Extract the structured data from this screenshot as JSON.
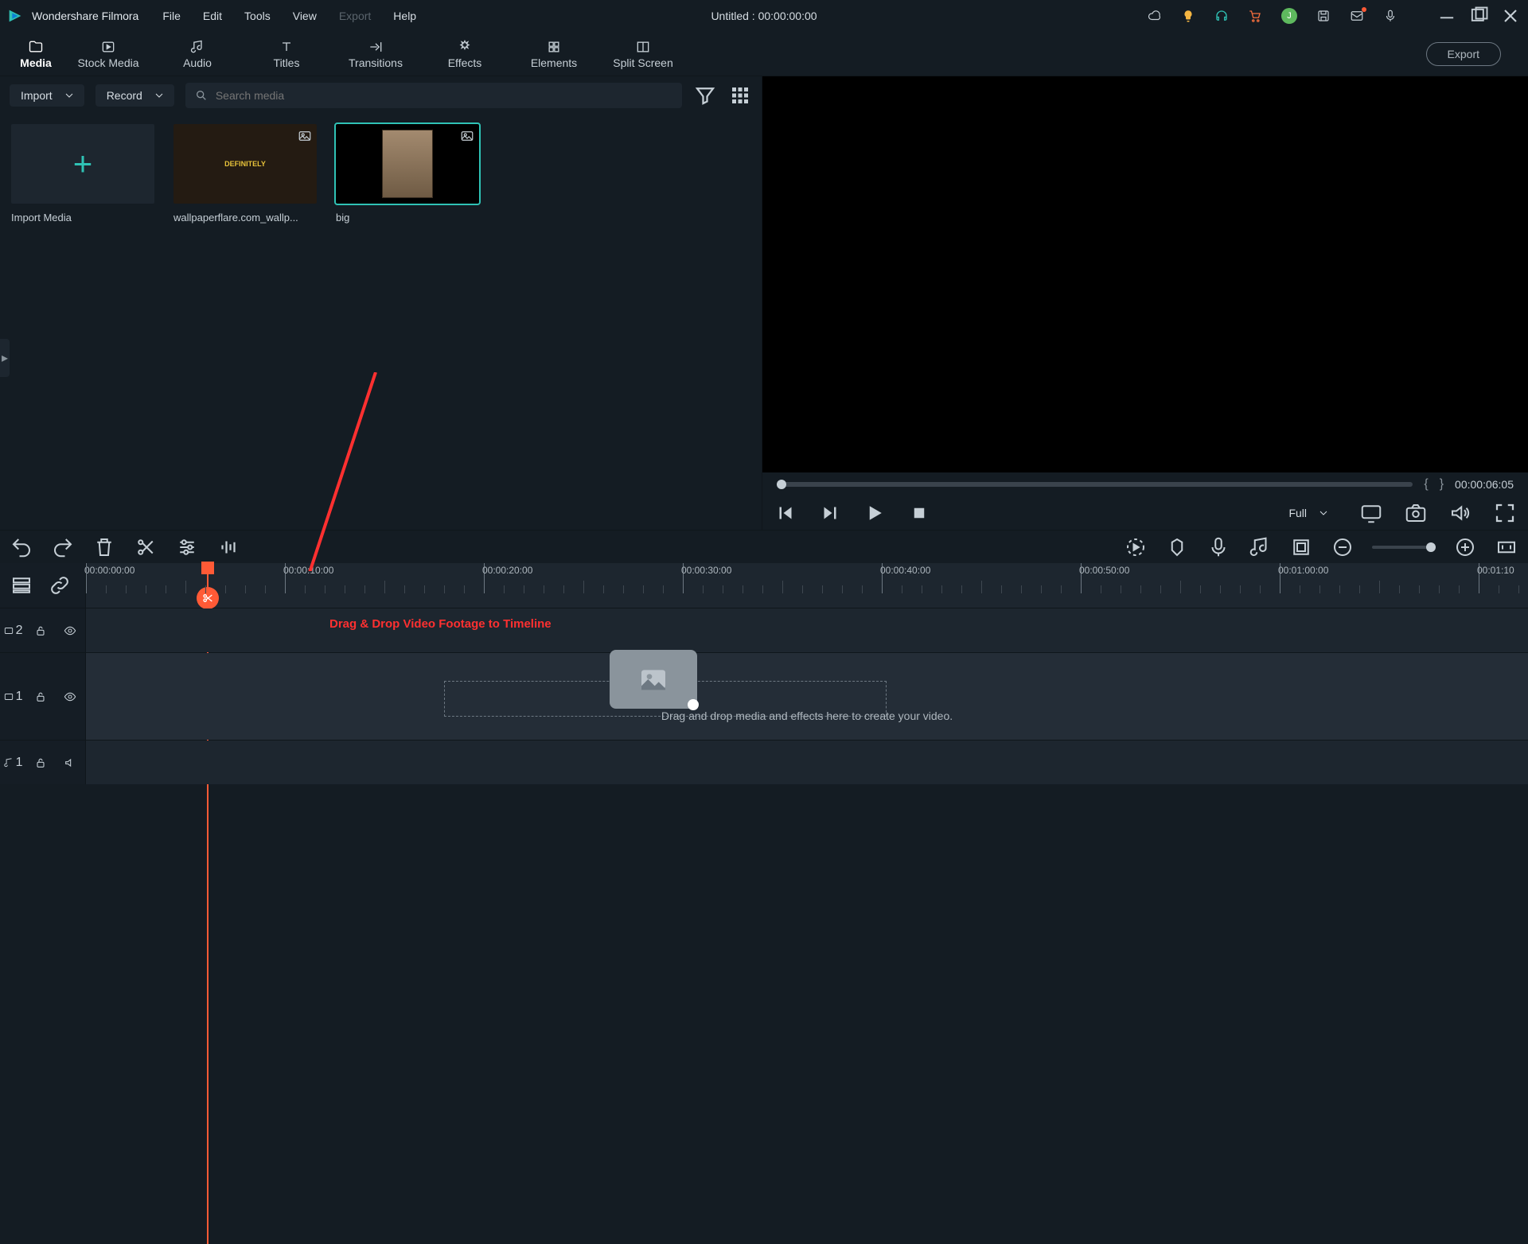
{
  "app": {
    "name": "Wondershare Filmora",
    "title_center": "Untitled : 00:00:00:00"
  },
  "menu": {
    "file": "File",
    "edit": "Edit",
    "tools": "Tools",
    "view": "View",
    "export": "Export",
    "help": "Help"
  },
  "nav": {
    "media": "Media",
    "stock": "Stock Media",
    "audio": "Audio",
    "titles": "Titles",
    "transitions": "Transitions",
    "effects": "Effects",
    "elements": "Elements",
    "split": "Split Screen",
    "export_btn": "Export"
  },
  "mediabar": {
    "import": "Import",
    "record": "Record",
    "search_placeholder": "Search media"
  },
  "tiles": {
    "import": "Import Media",
    "t1": "wallpaperflare.com_wallp...",
    "t2": "big"
  },
  "preview": {
    "time": "00:00:06:05",
    "mode": "Full"
  },
  "ruler": {
    "start": "00:00:00:00",
    "marks": [
      "00:00:10:00",
      "00:00:20:00",
      "00:00:30:00",
      "00:00:40:00",
      "00:00:50:00",
      "00:01:00:00",
      "00:01:10"
    ]
  },
  "tracks": {
    "v2": "2",
    "v1": "1",
    "a1": "1"
  },
  "annotation": {
    "drag": "Drag & Drop Video Footage to Timeline"
  },
  "timeline": {
    "drop": "Drag and drop media and effects here to create your video."
  },
  "icons": {
    "avatar_initial": "J"
  }
}
